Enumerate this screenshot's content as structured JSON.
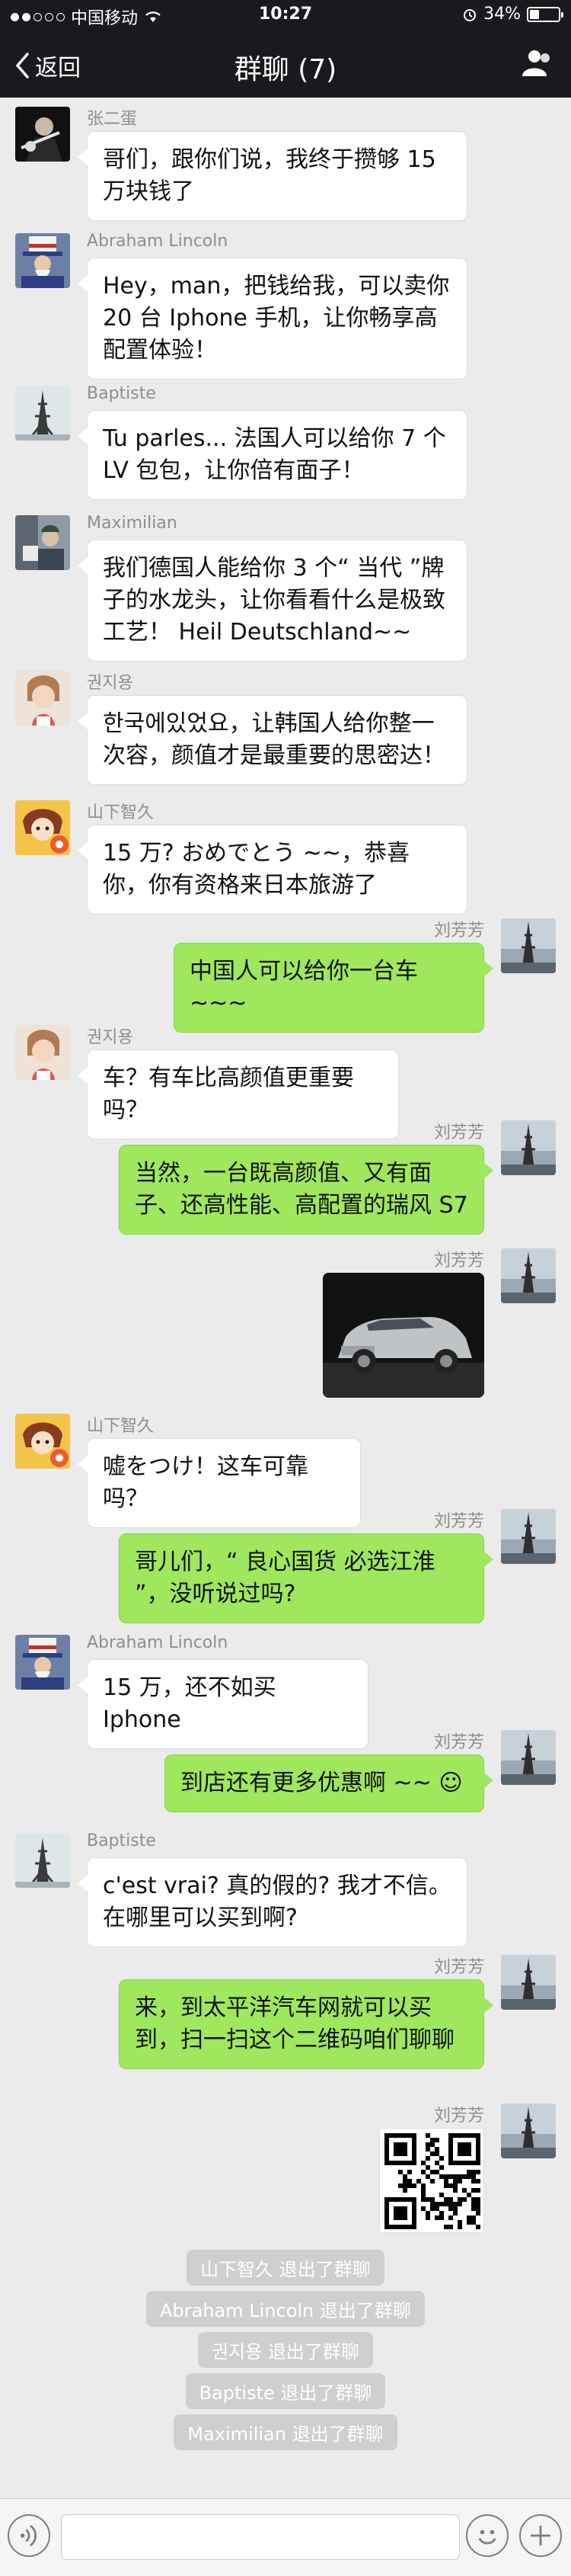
{
  "status_bar": {
    "carrier": "中国移动",
    "time": "10:27",
    "battery_percent": "34%",
    "battery_level": 0.34,
    "icons": [
      "signal-icon",
      "wifi-icon",
      "alarm-icon",
      "battery-icon"
    ]
  },
  "nav": {
    "back_label": "返回",
    "title": "群聊 (7)",
    "icons": [
      "chevron-left-icon",
      "group-members-icon"
    ]
  },
  "messages": [
    {
      "side": "left",
      "sender": "张二蛋",
      "text": "哥们，跟你们说，我终于攒够 15 万块钱了",
      "avatar": "guitarist-avatar"
    },
    {
      "side": "left",
      "sender": "Abraham Lincoln",
      "text": "Hey，man，把钱给我，可以卖你 20 台 Iphone 手机，让你畅享高配置体验！",
      "avatar": "uncle-sam-avatar"
    },
    {
      "side": "left",
      "sender": "Baptiste",
      "text": "Tu parles... 法国人可以给你 7 个 LV 包包，让你倍有面子！",
      "avatar": "eiffel-tower-avatar"
    },
    {
      "side": "left",
      "sender": "Maximilian",
      "text": "我们德国人能给你 3 个“ 当代 ”牌子的水龙头，让你看看什么是极致工艺！ Heil Deutschland~~",
      "avatar": "soldier-avatar"
    },
    {
      "side": "left",
      "sender": "권지용",
      "text": "한국에있었요，让韩国人给你整一次容，颜值才是最重要的思密达！",
      "avatar": "korean-star-avatar"
    },
    {
      "side": "left",
      "sender": "山下智久",
      "text": "15 万? おめでとう ~~，恭喜你，你有资格来日本旅游了",
      "avatar": "anime-avatar"
    },
    {
      "side": "right",
      "sender": "刘芳芳",
      "text": "中国人可以给你一台车 ~~~",
      "avatar": "paris-avatar"
    },
    {
      "side": "left",
      "sender": "권지용",
      "text": "车？有车比高颜值更重要吗？",
      "avatar": "korean-star-avatar"
    },
    {
      "side": "right",
      "sender": "刘芳芳",
      "text": "当然，一台既高颜值、又有面子、还高性能、高配置的瑞风 S7",
      "avatar": "paris-avatar"
    },
    {
      "side": "right",
      "sender": "刘芳芳",
      "image": "suv-car-image",
      "avatar": "paris-avatar"
    },
    {
      "side": "left",
      "sender": "山下智久",
      "text": "嘘をつけ！这车可靠吗？",
      "avatar": "anime-avatar"
    },
    {
      "side": "right",
      "sender": "刘芳芳",
      "text": "哥儿们，“ 良心国货 必选江淮 ”，没听说过吗?",
      "avatar": "paris-avatar"
    },
    {
      "side": "left",
      "sender": "Abraham Lincoln",
      "text": "15 万，还不如买 Iphone",
      "avatar": "uncle-sam-avatar"
    },
    {
      "side": "right",
      "sender": "刘芳芳",
      "text": "到店还有更多优惠啊 ~~ ☺",
      "avatar": "paris-avatar"
    },
    {
      "side": "left",
      "sender": "Baptiste",
      "text": "c'est vrai? 真的假的? 我才不信。在哪里可以买到啊?",
      "avatar": "eiffel-tower-avatar"
    },
    {
      "side": "right",
      "sender": "刘芳芳",
      "text": "来，到太平洋汽车网就可以买到，扫一扫这个二维码咱们聊聊",
      "avatar": "paris-avatar"
    },
    {
      "side": "right",
      "sender": "刘芳芳",
      "image": "qr-code-image",
      "avatar": "paris-avatar"
    }
  ],
  "system_messages": [
    "山下智久 退出了群聊",
    "Abraham Lincoln 退出了群聊",
    "권지용 退出了群聊",
    "Baptiste 退出了群聊",
    "Maximilian 退出了群聊"
  ],
  "input_bar": {
    "placeholder": "",
    "icons": [
      "voice-icon",
      "emoji-icon",
      "plus-icon"
    ]
  }
}
